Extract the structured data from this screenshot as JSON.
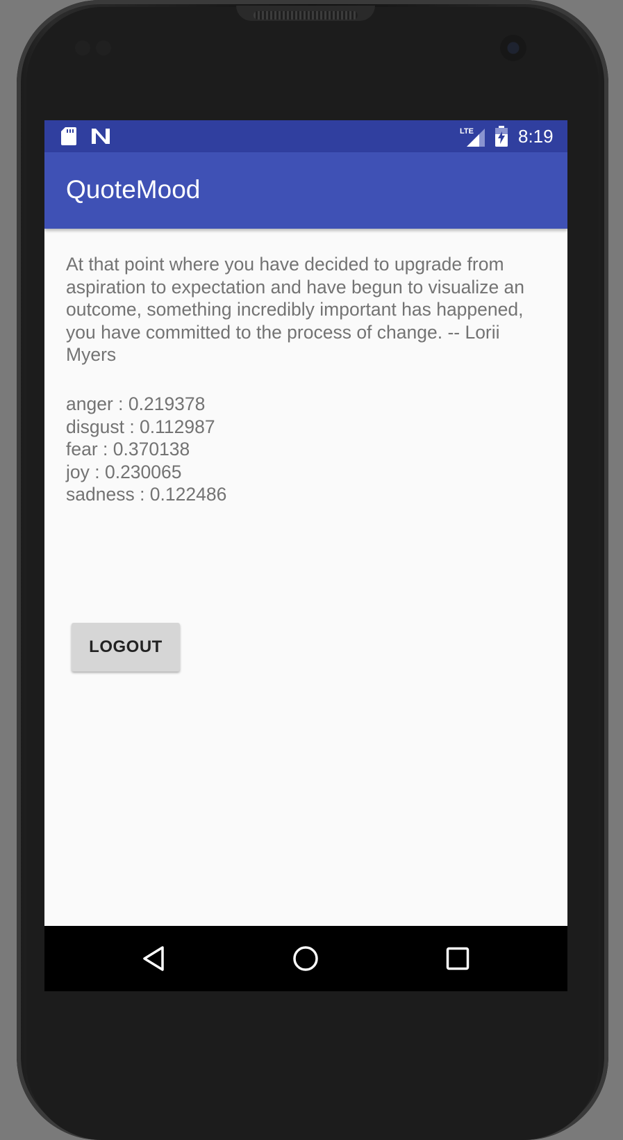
{
  "status_bar": {
    "time": "8:19",
    "network": "LTE",
    "icons": [
      "sd-card-icon",
      "n-notification-icon",
      "lte-signal-icon",
      "battery-charging-icon"
    ]
  },
  "app_bar": {
    "title": "QuoteMood"
  },
  "quote": {
    "text": "At that point where you have decided to upgrade from aspiration to expectation and have begun to visualize an outcome, something incredibly important has happened, you have committed to the process of change. -- Lorii Myers"
  },
  "emotions": [
    {
      "label": "anger : 0.219378"
    },
    {
      "label": "disgust : 0.112987"
    },
    {
      "label": "fear : 0.370138"
    },
    {
      "label": "joy : 0.230065"
    },
    {
      "label": "sadness : 0.122486"
    }
  ],
  "logout_button": {
    "label": "LOGOUT"
  },
  "nav_bar": {
    "buttons": [
      "back-icon",
      "home-icon",
      "recents-icon"
    ]
  },
  "colors": {
    "status_bar": "#303f9f",
    "app_bar": "#3f51b5",
    "background": "#fafafa",
    "body_text": "#737373",
    "button": "#d6d6d6"
  }
}
